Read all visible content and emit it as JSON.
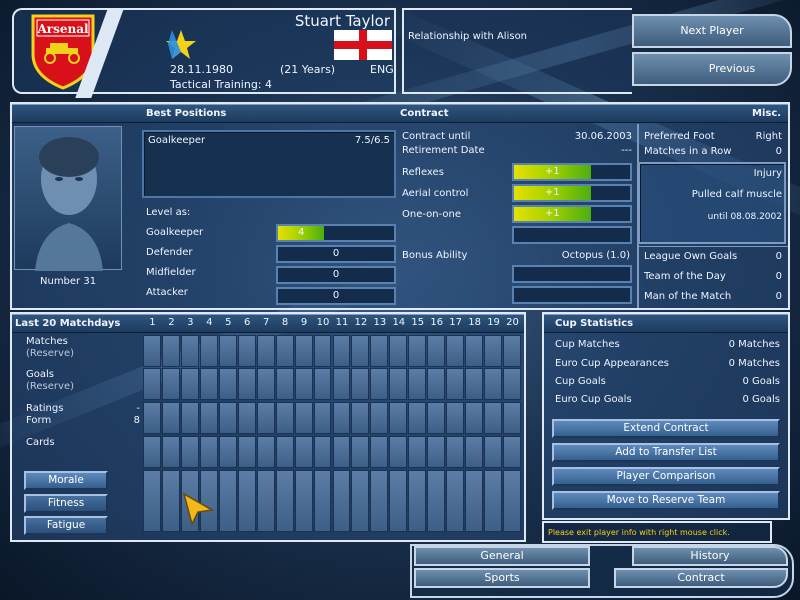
{
  "player": {
    "name": "Stuart Taylor",
    "birthdate": "28.11.1980",
    "age": "(21 Years)",
    "nationality": "ENG",
    "tactical_training": "Tactical Training: 4",
    "number": "Number 31"
  },
  "club": {
    "badge_text": "Arsenal"
  },
  "relationship": "Relationship with Alison",
  "nav": {
    "next_player": "Next Player",
    "previous": "Previous"
  },
  "sections": {
    "best_positions": "Best Positions",
    "contract": "Contract",
    "misc": "Misc.",
    "last20": "Last 20 Matchdays",
    "cup_stats": "Cup Statistics"
  },
  "best_positions": {
    "primary_label": "Goalkeeper",
    "primary_rating": "7.5/6.5",
    "level_as": "Level as:",
    "rows": [
      {
        "label": "Goalkeeper",
        "value": "4",
        "level": 0.4
      },
      {
        "label": "Defender",
        "value": "0",
        "level": 0
      },
      {
        "label": "Midfielder",
        "value": "0",
        "level": 0
      },
      {
        "label": "Attacker",
        "value": "0",
        "level": 0
      }
    ]
  },
  "contract": {
    "until_label": "Contract until",
    "until_value": "30.06.2003",
    "retirement_label": "Retirement Date",
    "retirement_value": "---",
    "skills": [
      {
        "label": "Reflexes",
        "value": "+1"
      },
      {
        "label": "Aerial control",
        "value": "+1"
      },
      {
        "label": "One-on-one",
        "value": "+1"
      }
    ],
    "bonus_label": "Bonus Ability",
    "bonus_value": "Octopus (1.0)"
  },
  "misc": {
    "preferred_foot_label": "Preferred Foot",
    "preferred_foot_value": "Right",
    "matches_row_label": "Matches in a Row",
    "matches_row_value": "0",
    "injury_label": "Injury",
    "injury_desc": "Pulled calf muscle",
    "injury_until": "until 08.08.2002",
    "league_goals_label": "League Own Goals",
    "league_goals_value": "0",
    "team_day_label": "Team of the Day",
    "team_day_value": "0",
    "motm_label": "Man of the Match",
    "motm_value": "0"
  },
  "matchdays": {
    "numbers": [
      "1",
      "2",
      "3",
      "4",
      "5",
      "6",
      "7",
      "8",
      "9",
      "10",
      "11",
      "12",
      "13",
      "14",
      "15",
      "16",
      "17",
      "18",
      "19",
      "20"
    ],
    "rows": {
      "matches": "Matches",
      "matches_sub": "(Reserve)",
      "goals": "Goals",
      "goals_sub": "(Reserve)",
      "ratings": "Ratings",
      "ratings_value": "-",
      "form": "Form",
      "form_value": "8",
      "cards": "Cards"
    },
    "buttons": {
      "morale": "Morale",
      "fitness": "Fitness",
      "fatigue": "Fatigue"
    }
  },
  "cup": {
    "rows": [
      {
        "label": "Cup Matches",
        "value": "0 Matches"
      },
      {
        "label": "Euro Cup Appearances",
        "value": "0 Matches"
      },
      {
        "label": "Cup Goals",
        "value": "0 Goals"
      },
      {
        "label": "Euro Cup Goals",
        "value": "0 Goals"
      }
    ],
    "actions": {
      "extend": "Extend Contract",
      "transfer": "Add to Transfer List",
      "compare": "Player Comparison",
      "reserve": "Move to Reserve Team"
    },
    "hint": "Please exit player info with right mouse click."
  },
  "bottom_tabs": {
    "general": "General",
    "sports": "Sports",
    "history": "History",
    "contract": "Contract"
  },
  "colors": {
    "accent_yellow": "#f3d21c",
    "bar_green": "#4cae10",
    "badge_red": "#d7101a",
    "panel_border": "#dfe8f5"
  }
}
